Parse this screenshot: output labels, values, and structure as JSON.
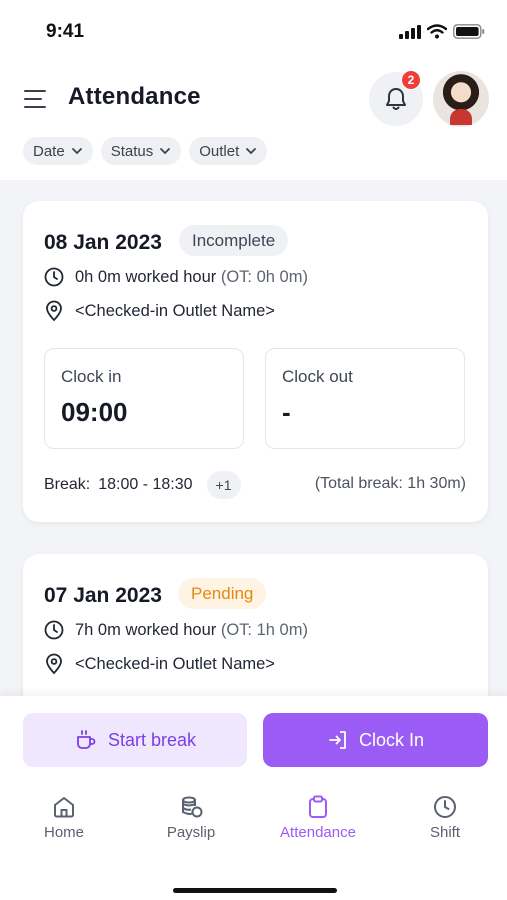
{
  "status_bar": {
    "time": "9:41"
  },
  "header": {
    "title": "Attendance",
    "notification_count": "2"
  },
  "filters": [
    {
      "label": "Date"
    },
    {
      "label": "Status"
    },
    {
      "label": "Outlet"
    }
  ],
  "cards": [
    {
      "date": "08 Jan 2023",
      "status": "Incomplete",
      "worked_text": "0h 0m worked hour",
      "ot_text": "(OT: 0h 0m)",
      "outlet": "<Checked-in Outlet Name>",
      "clock_in_label": "Clock in",
      "clock_in_value": "09:00",
      "clock_out_label": "Clock out",
      "clock_out_value": "-",
      "break_label": "Break:",
      "break_range": "18:00 - 18:30",
      "break_more": "+1",
      "total_break": "(Total break: 1h 30m)"
    },
    {
      "date": "07 Jan 2023",
      "status": "Pending",
      "worked_text": "7h 0m worked hour",
      "ot_text": "(OT: 1h 0m)",
      "outlet": "<Checked-in Outlet Name>"
    }
  ],
  "actions": {
    "start_break": "Start break",
    "clock_in": "Clock In"
  },
  "nav": [
    {
      "label": "Home",
      "icon": "home-icon"
    },
    {
      "label": "Payslip",
      "icon": "coins-icon"
    },
    {
      "label": "Attendance",
      "icon": "clipboard-icon",
      "active": true
    },
    {
      "label": "Shift",
      "icon": "clock-icon"
    }
  ],
  "colors": {
    "accent": "#9a5cf5",
    "accent_light": "#efe7fd",
    "pending": "#e08a12",
    "badge": "#ef3e3a"
  }
}
